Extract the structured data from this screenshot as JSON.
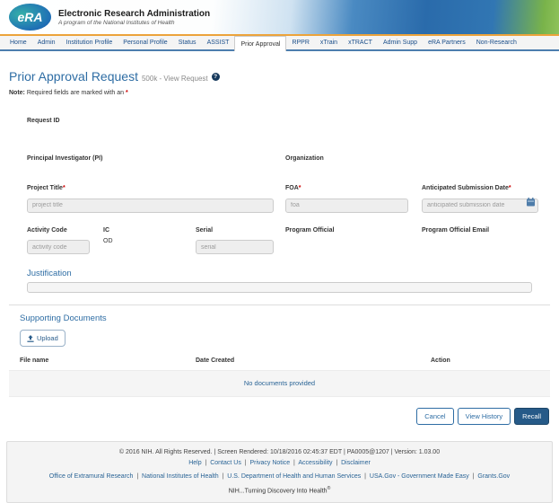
{
  "colors": {
    "accent_orange": "#eca33b",
    "nav_border_blue": "#4d7eae",
    "heading_blue": "#2e6da4",
    "link_blue": "#2a6496",
    "primary_button_blue": "#265a88",
    "required_red": "#cc0000"
  },
  "header": {
    "logo_text": "eRA",
    "title": "Electronic Research Administration",
    "subtitle": "A program of the National Institutes of Health"
  },
  "nav": {
    "items": [
      {
        "label": "Home",
        "active": false
      },
      {
        "label": "Admin",
        "active": false
      },
      {
        "label": "Institution Profile",
        "active": false
      },
      {
        "label": "Personal Profile",
        "active": false
      },
      {
        "label": "Status",
        "active": false
      },
      {
        "label": "ASSIST",
        "active": false
      },
      {
        "label": "Prior Approval",
        "active": true
      },
      {
        "label": "RPPR",
        "active": false
      },
      {
        "label": "xTrain",
        "active": false
      },
      {
        "label": "xTRACT",
        "active": false
      },
      {
        "label": "Admin Supp",
        "active": false
      },
      {
        "label": "eRA Partners",
        "active": false
      },
      {
        "label": "Non-Research",
        "active": false
      }
    ]
  },
  "page": {
    "title": "Prior Approval Request",
    "subtitle": "500k - View Request",
    "help_icon": "?",
    "note_label": "Note:",
    "note_text": " Required fields are marked with an ",
    "required_mark": "*"
  },
  "form": {
    "request_id_label": "Request ID",
    "pi_label": "Principal Investigator (PI)",
    "organization_label": "Organization",
    "project_title_label": "Project Title",
    "project_title_placeholder": "project title",
    "foa_label": "FOA",
    "foa_placeholder": "foa",
    "submission_date_label": "Anticipated Submission Date",
    "submission_date_placeholder": "anticipated submission date",
    "activity_code_label": "Activity Code",
    "activity_code_placeholder": "activity code",
    "ic_label": "IC",
    "ic_value": "OD",
    "serial_label": "Serial",
    "serial_placeholder": "serial",
    "program_official_label": "Program Official",
    "program_official_email_label": "Program Official Email",
    "justification_heading": "Justification"
  },
  "documents": {
    "heading": "Supporting Documents",
    "upload_label": "Upload",
    "columns": [
      "File name",
      "Date Created",
      "Action"
    ],
    "empty_message": "No documents provided"
  },
  "actions": {
    "cancel": "Cancel",
    "view_history": "View History",
    "recall": "Recall"
  },
  "footer": {
    "copyright": "© 2016 NIH. All Rights Reserved. | Screen Rendered:  10/18/2016 02:45:37 EDT | PA0005@1207 | Version: 1.03.00",
    "help_links": [
      "Help",
      "Contact Us",
      "Privacy Notice",
      "Accessibility",
      "Disclaimer"
    ],
    "org_links": [
      "Office of Extramural Research",
      "National Institutes of Health",
      "U.S. Department of Health and Human Services",
      "USA.Gov - Government Made Easy",
      "Grants.Gov"
    ],
    "tagline": "NIH...Turning Discovery Into Health",
    "tagline_sup": "®"
  }
}
